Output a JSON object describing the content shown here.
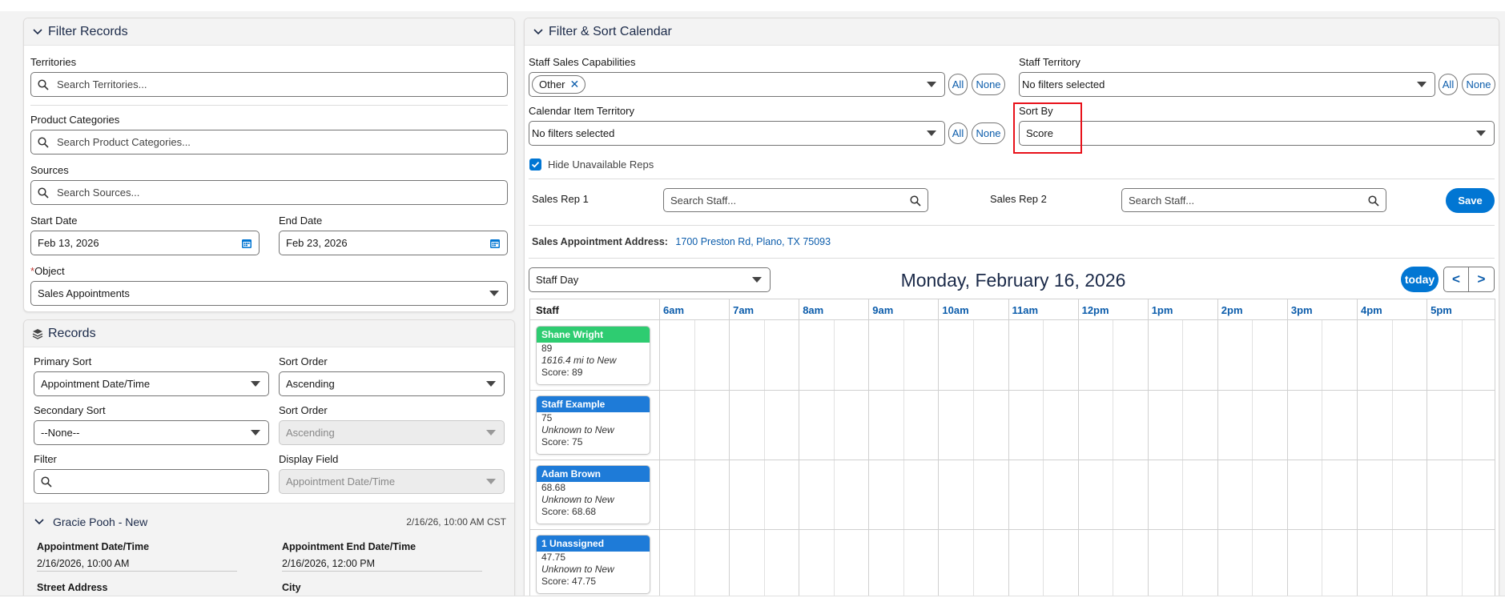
{
  "filter_records": {
    "title": "Filter Records",
    "territories": {
      "label": "Territories",
      "placeholder": "Search Territories..."
    },
    "product_categories": {
      "label": "Product Categories",
      "placeholder": "Search Product Categories..."
    },
    "sources": {
      "label": "Sources",
      "placeholder": "Search Sources..."
    },
    "start_date": {
      "label": "Start Date",
      "value": "Feb 13, 2026"
    },
    "end_date": {
      "label": "End Date",
      "value": "Feb 23, 2026"
    },
    "object": {
      "required_mark": "*",
      "label": "Object",
      "value": "Sales Appointments"
    }
  },
  "records": {
    "title": "Records",
    "primary_sort": {
      "label": "Primary Sort",
      "value": "Appointment Date/Time"
    },
    "sort_order_1": {
      "label": "Sort Order",
      "value": "Ascending"
    },
    "secondary_sort": {
      "label": "Secondary Sort",
      "value": "--None--"
    },
    "sort_order_2": {
      "label": "Sort Order",
      "value": "Ascending"
    },
    "filter": {
      "label": "Filter",
      "value": ""
    },
    "display_field": {
      "label": "Display Field",
      "value": "Appointment Date/Time"
    },
    "record": {
      "name": "Gracie Pooh - New",
      "datetime": "2/16/26, 10:00 AM CST",
      "appt_start_label": "Appointment Date/Time",
      "appt_start_value": "2/16/2026, 10:00 AM",
      "appt_end_label": "Appointment End Date/Time",
      "appt_end_value": "2/16/2026, 12:00 PM",
      "street_label": "Street Address",
      "city_label": "City"
    }
  },
  "calendar": {
    "title": "Filter & Sort Calendar",
    "staff_sales_capabilities": {
      "label": "Staff Sales Capabilities",
      "pill": "Other",
      "all": "All",
      "none": "None"
    },
    "staff_territory": {
      "label": "Staff Territory",
      "value": "No filters selected",
      "all": "All",
      "none": "None"
    },
    "calendar_item_territory": {
      "label": "Calendar Item Territory",
      "value": "No filters selected",
      "all": "All",
      "none": "None"
    },
    "sort_by": {
      "label": "Sort By",
      "value": "Score"
    },
    "hide_unavailable": {
      "label": "Hide Unavailable Reps",
      "checked": true
    },
    "sales_rep_1": {
      "label": "Sales Rep 1",
      "placeholder": "Search Staff..."
    },
    "sales_rep_2": {
      "label": "Sales Rep 2",
      "placeholder": "Search Staff..."
    },
    "save": "Save",
    "address_label": "Sales Appointment Address:",
    "address_value": "1700 Preston Rd, Plano, TX 75093",
    "view": "Staff Day",
    "date_heading": "Monday, February 16, 2026",
    "today": "today",
    "prev": "<",
    "next": ">",
    "staff_header": "Staff",
    "hours": [
      "6am",
      "7am",
      "8am",
      "9am",
      "10am",
      "11am",
      "12pm",
      "1pm",
      "2pm",
      "3pm",
      "4pm",
      "5pm"
    ],
    "staff": [
      {
        "name": "Shane Wright",
        "color": "#2ecc71",
        "score_num": "89",
        "distance": "1616.4 mi to New",
        "score": "Score: 89"
      },
      {
        "name": "Staff Example",
        "color": "#1e7bd8",
        "score_num": "75",
        "distance": "Unknown to New",
        "score": "Score: 75"
      },
      {
        "name": "Adam Brown",
        "color": "#1e7bd8",
        "score_num": "68.68",
        "distance": "Unknown to New",
        "score": "Score: 68.68"
      },
      {
        "name": "1 Unassigned",
        "color": "#1e7bd8",
        "score_num": "47.75",
        "distance": "Unknown to New",
        "score": "Score: 47.75"
      }
    ]
  },
  "colors": {
    "brand": "#0176d3",
    "link": "#0b5cab",
    "highlight": "#e8111a"
  }
}
